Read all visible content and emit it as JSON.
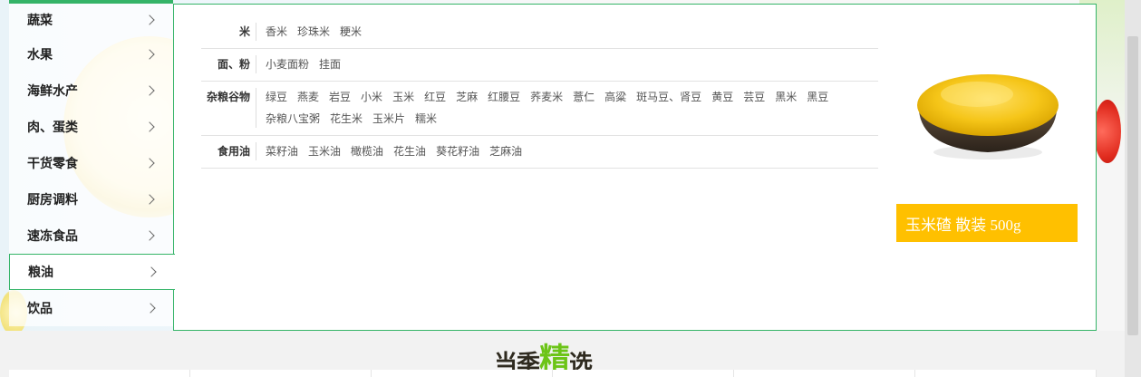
{
  "sidebar": {
    "items": [
      {
        "label": "蔬菜"
      },
      {
        "label": "水果"
      },
      {
        "label": "海鲜水产"
      },
      {
        "label": "肉、蛋类"
      },
      {
        "label": "干货零食"
      },
      {
        "label": "厨房调料"
      },
      {
        "label": "速冻食品"
      },
      {
        "label": "粮油"
      },
      {
        "label": "饮品"
      }
    ],
    "active_index": 7
  },
  "menu": {
    "rows": [
      {
        "title": "米",
        "items": [
          "香米",
          "珍珠米",
          "粳米"
        ]
      },
      {
        "title": "面、粉",
        "items": [
          "小麦面粉",
          "挂面"
        ]
      },
      {
        "title": "杂粮谷物",
        "items": [
          "绿豆",
          "燕麦",
          "岩豆",
          "小米",
          "玉米",
          "红豆",
          "芝麻",
          "红腰豆",
          "荞麦米",
          "薏仁",
          "高粱",
          "斑马豆、肾豆",
          "黄豆",
          "芸豆",
          "黑米",
          "黑豆",
          "杂粮八宝粥",
          "花生米",
          "玉米片",
          "糯米"
        ]
      },
      {
        "title": "食用油",
        "items": [
          "菜籽油",
          "玉米油",
          "橄榄油",
          "花生油",
          "葵花籽油",
          "芝麻油"
        ]
      }
    ]
  },
  "promo": {
    "label": "玉米碴 散装 500g",
    "color": "#ffc000"
  },
  "brand": {
    "part1": "当季",
    "part2": "精",
    "part3": "选"
  },
  "colors": {
    "accent": "#35b468"
  }
}
